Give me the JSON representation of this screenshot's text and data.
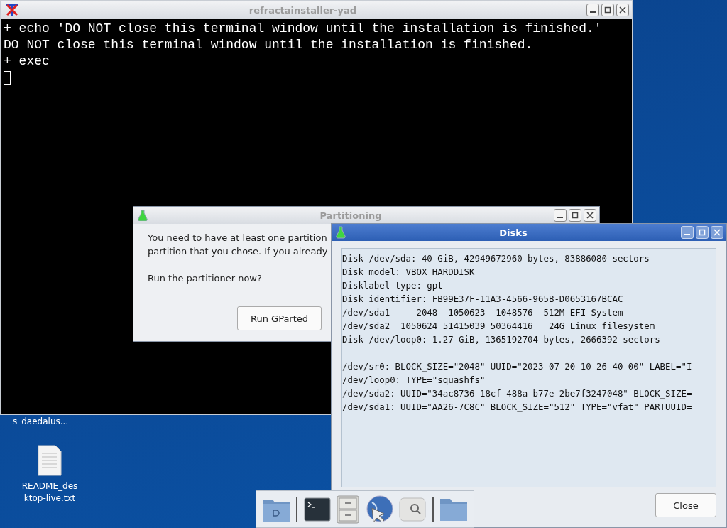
{
  "desktop_icons": [
    {
      "label": "s_daedalus..."
    },
    {
      "label": "README_des\nktop-live.txt"
    }
  ],
  "terminal": {
    "title": "refractainstaller-yad",
    "lines": [
      "+ echo 'DO NOT close this terminal window until the installation is finished.'",
      "DO NOT close this terminal window until the installation is finished.",
      "+ exec"
    ]
  },
  "partitioning": {
    "title": "Partitioning",
    "paragraphs": [
      [
        "You need to have at least one partition",
        "partition that you chose. If you already"
      ],
      [
        "Run the partitioner now?"
      ]
    ],
    "buttons": [
      "Run GParted"
    ]
  },
  "disks": {
    "title": "Disks",
    "blocks": [
      [
        "Disk /dev/sda: 40 GiB, 42949672960 bytes, 83886080 sectors",
        "Disk model: VBOX HARDDISK",
        "Disklabel type: gpt",
        "Disk identifier: FB99E37F-11A3-4566-965B-D0653167BCAC",
        "/dev/sda1     2048  1050623  1048576  512M EFI System",
        "/dev/sda2  1050624 51415039 50364416   24G Linux filesystem",
        "Disk /dev/loop0: 1.27 GiB, 1365192704 bytes, 2666392 sectors"
      ],
      [
        "/dev/sr0: BLOCK_SIZE=\"2048\" UUID=\"2023-07-20-10-26-40-00\" LABEL=\"I",
        "/dev/loop0: TYPE=\"squashfs\"",
        "/dev/sda2: UUID=\"34ac8736-18cf-488a-b77e-2be7f3247048\" BLOCK_SIZE=",
        "/dev/sda1: UUID=\"AA26-7C8C\" BLOCK_SIZE=\"512\" TYPE=\"vfat\" PARTUUID="
      ]
    ],
    "close_button": "Close"
  },
  "dock": [
    {
      "kind": "folder-drive"
    },
    {
      "kind": "terminal"
    },
    {
      "kind": "cabinet"
    },
    {
      "kind": "globe"
    },
    {
      "kind": "search"
    },
    {
      "kind": "folder"
    }
  ]
}
